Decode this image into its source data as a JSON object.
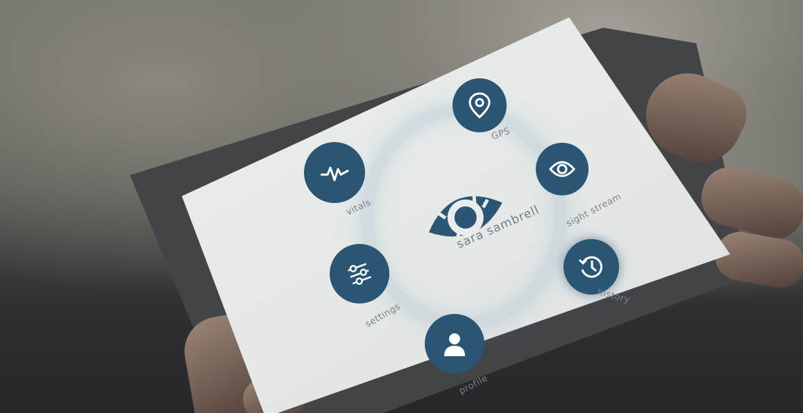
{
  "colors": {
    "accent": "#2a5573",
    "screen": "#e9ecec",
    "label": "#7a8286",
    "bezel": "#434448"
  },
  "user": {
    "name": "sara sambrell"
  },
  "apps": [
    {
      "label": "GPS",
      "icon": "location-pin-icon"
    },
    {
      "label": "sight stream",
      "icon": "eye-icon"
    },
    {
      "label": "history",
      "icon": "history-clock-icon"
    },
    {
      "label": "profile",
      "icon": "person-icon"
    },
    {
      "label": "settings",
      "icon": "sliders-icon"
    },
    {
      "label": "vitals",
      "icon": "heartbeat-icon"
    }
  ]
}
